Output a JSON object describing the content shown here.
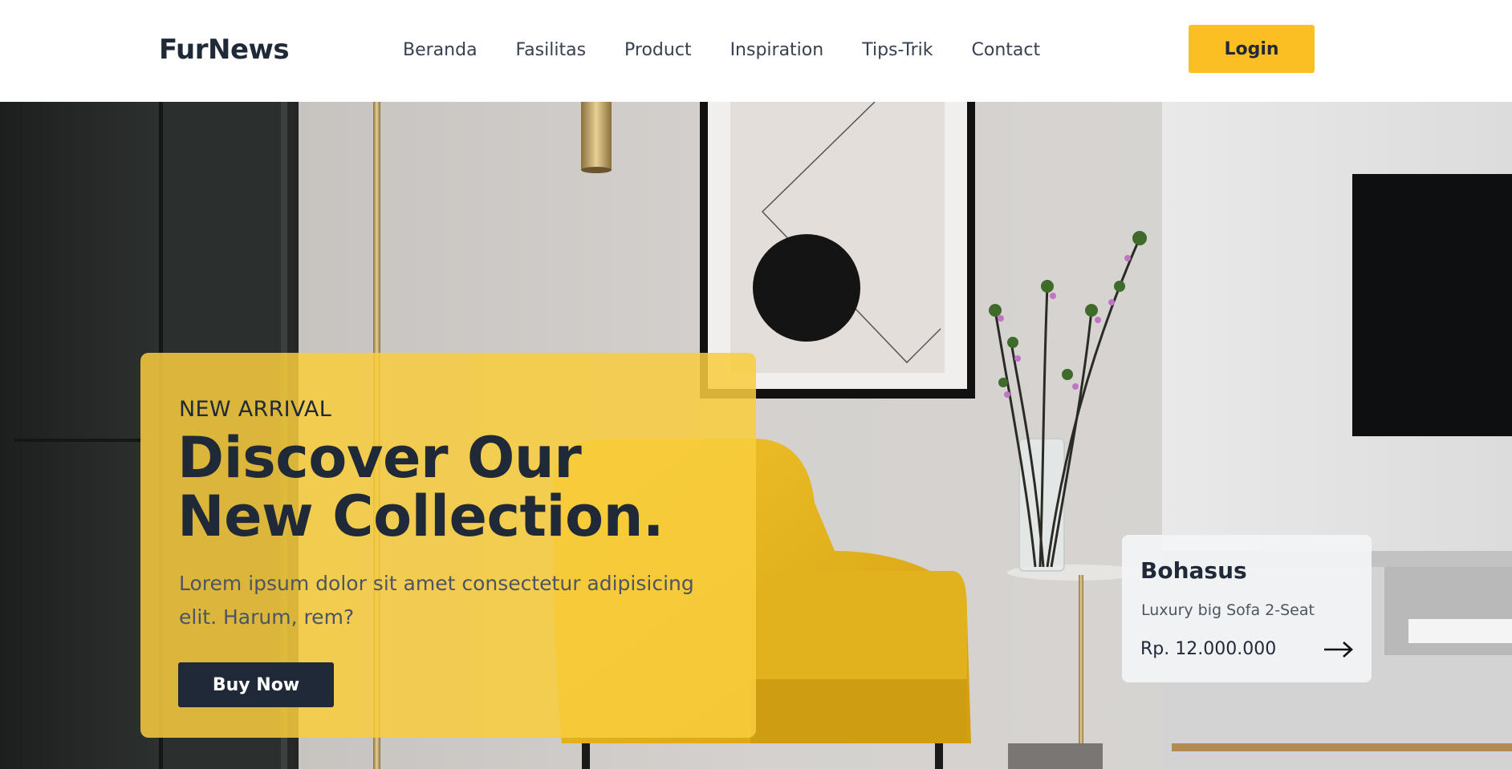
{
  "header": {
    "logo": "FurNews",
    "nav": [
      "Beranda",
      "Fasilitas",
      "Product",
      "Inspiration",
      "Tips-Trik",
      "Contact"
    ],
    "login_label": "Login"
  },
  "hero": {
    "eyebrow": "NEW ARRIVAL",
    "title": "Discover Our New Collection.",
    "text": "Lorem ipsum dolor sit amet consectetur adipisicing elit. Harum, rem?",
    "cta_label": "Buy Now"
  },
  "product_card": {
    "name": "Bohasus",
    "description": "Luxury big Sofa 2-Seat",
    "price": "Rp. 12.000.000",
    "arrow_icon": "arrow-right-icon"
  },
  "colors": {
    "accent": "#fbbf24",
    "dark": "#1f2937"
  }
}
